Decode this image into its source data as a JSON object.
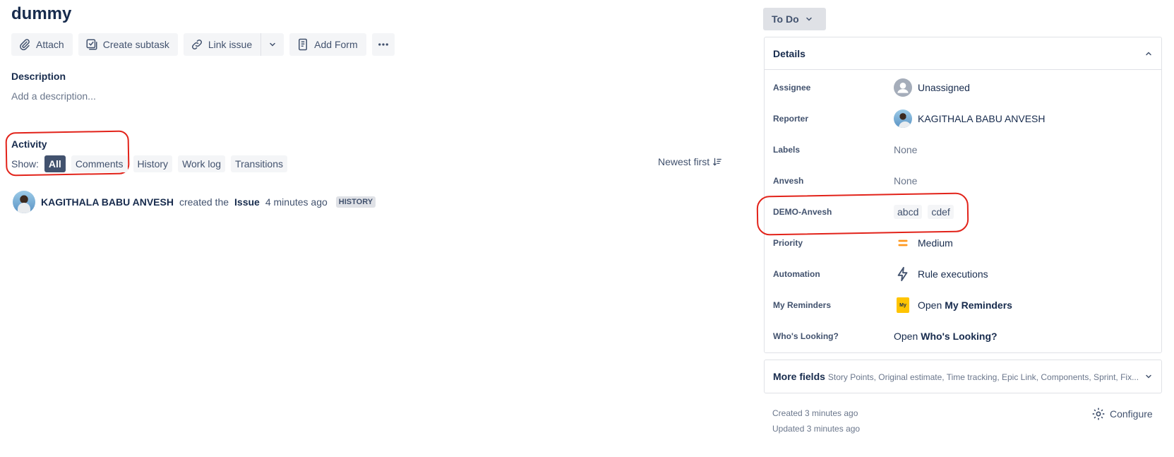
{
  "issue": {
    "title": "dummy"
  },
  "toolbar": {
    "attach": "Attach",
    "create_subtask": "Create subtask",
    "link_issue": "Link issue",
    "add_form": "Add Form"
  },
  "description": {
    "label": "Description",
    "placeholder": "Add a description..."
  },
  "activity": {
    "label": "Activity",
    "show_label": "Show:",
    "filters": [
      "All",
      "Comments",
      "History",
      "Work log",
      "Transitions"
    ],
    "sort_label": "Newest first",
    "entry": {
      "user": "KAGITHALA BABU ANVESH",
      "action": "created the",
      "object": "Issue",
      "time": "4 minutes ago",
      "badge": "HISTORY"
    }
  },
  "status": {
    "label": "To Do"
  },
  "details": {
    "title": "Details",
    "fields": {
      "assignee": {
        "label": "Assignee",
        "value": "Unassigned"
      },
      "reporter": {
        "label": "Reporter",
        "value": "KAGITHALA BABU ANVESH"
      },
      "labels": {
        "label": "Labels",
        "value": "None"
      },
      "anvesh": {
        "label": "Anvesh",
        "value": "None"
      },
      "demo": {
        "label": "DEMO-Anvesh",
        "values": [
          "abcd",
          "cdef"
        ]
      },
      "priority": {
        "label": "Priority",
        "value": "Medium"
      },
      "automation": {
        "label": "Automation",
        "value": "Rule executions"
      },
      "reminders": {
        "label": "My Reminders",
        "prefix": "Open",
        "link": "My Reminders",
        "logo_text": "My"
      },
      "looking": {
        "label": "Who's Looking?",
        "prefix": "Open",
        "link": "Who's Looking?"
      }
    }
  },
  "more_fields": {
    "title": "More fields",
    "subtitle": "Story Points, Original estimate, Time tracking, Epic Link, Components, Sprint, Fix..."
  },
  "meta": {
    "created": "Created 3 minutes ago",
    "updated": "Updated 3 minutes ago"
  },
  "configure": {
    "label": "Configure"
  },
  "colors": {
    "priority_medium": "#ff991f",
    "annotation": "#e2231a",
    "active_chip": "#42526e"
  }
}
